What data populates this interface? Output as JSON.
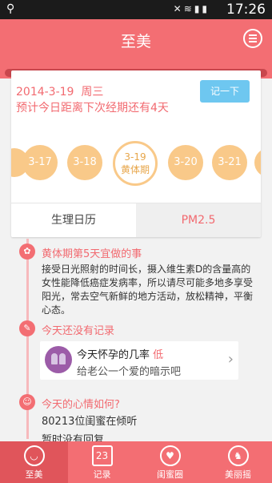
{
  "status": {
    "time": "17:26"
  },
  "header": {
    "title": "至美"
  },
  "card": {
    "date": "2014-3-19",
    "weekday": "周三",
    "prediction": "预计今日距离下次经期还有4天",
    "record_button": "记一下",
    "days": [
      {
        "label": "3-17"
      },
      {
        "label": "3-18"
      },
      {
        "label": "3-19",
        "sub": "黄体期"
      },
      {
        "label": "3-20"
      },
      {
        "label": "3-21"
      }
    ],
    "tabs": [
      "生理日历",
      "PM2.5"
    ]
  },
  "sections": {
    "tip_title": "黄体期第5天宜做的事",
    "tip_body": "接受日光照射的时间长，摄入维生素D的含量高的女性能降低癌症发病率，所以请尽可能多地多享受阳光，常去空气新鲜的地方活动，放松精神，平衡心态。",
    "record_title": "今天还没有记录",
    "record_line1": "今天怀孕的几率",
    "record_level": "低",
    "record_line2": "给老公一个爱的暗示吧",
    "mood_title": "今天的心情如何?",
    "mood_body1": "80213位闺蜜在倾听",
    "mood_body2": "暂时没有回复"
  },
  "nav": {
    "items": [
      {
        "label": "至美"
      },
      {
        "label": "记录",
        "icon_text": "23"
      },
      {
        "label": "闺蜜圈"
      },
      {
        "label": "美丽摇"
      }
    ]
  },
  "colors": {
    "brand": "#f36e73",
    "accent_orange": "#f9c989",
    "button_blue": "#6ec7f0"
  }
}
